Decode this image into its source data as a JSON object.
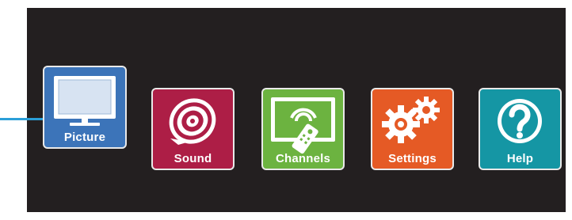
{
  "menu": {
    "selected": "picture",
    "items": [
      {
        "id": "picture",
        "label": "Picture",
        "icon": "tv-icon",
        "color": "#3c74b9"
      },
      {
        "id": "sound",
        "label": "Sound",
        "icon": "speaker-icon",
        "color": "#ad1e46"
      },
      {
        "id": "channels",
        "label": "Channels",
        "icon": "tv-remote-icon",
        "color": "#6cb340"
      },
      {
        "id": "settings",
        "label": "Settings",
        "icon": "gears-icon",
        "color": "#e55a25"
      },
      {
        "id": "help",
        "label": "Help",
        "icon": "question-mark-icon",
        "color": "#1596a4"
      }
    ]
  },
  "colors": {
    "background": "#231f20",
    "selection_indicator": "#2b9fd8",
    "tile_border": "#e9e9e9"
  }
}
